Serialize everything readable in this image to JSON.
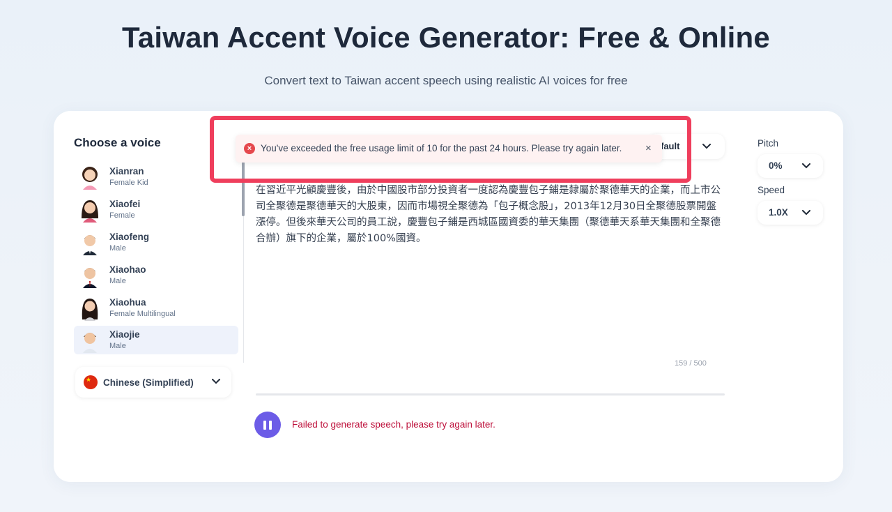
{
  "page": {
    "title": "Taiwan Accent Voice Generator: Free & Online",
    "subtitle": "Convert text to Taiwan accent speech using realistic AI voices for free"
  },
  "voices": {
    "heading": "Choose a voice",
    "items": [
      {
        "name": "Xianran",
        "desc": "Female Kid",
        "selected": false
      },
      {
        "name": "Xiaofei",
        "desc": "Female",
        "selected": false
      },
      {
        "name": "Xiaofeng",
        "desc": "Male",
        "selected": false
      },
      {
        "name": "Xiaohao",
        "desc": "Male",
        "selected": false
      },
      {
        "name": "Xiaohua",
        "desc": "Female Multilingual",
        "selected": false
      },
      {
        "name": "Xiaojie",
        "desc": "Male",
        "selected": true
      }
    ],
    "language": "Chinese (Simplified)"
  },
  "editor": {
    "style_label": "fault",
    "text": "在習近平光顧慶豐後，由於中國股市部分投資者一度認為慶豐包子鋪是隸屬於聚德華天的企業，而上市公司全聚德是聚德華天的大股東，因而市場視全聚德為「包子概念股」，2013年12月30日全聚德股票開盤漲停。但後來華天公司的員工說，慶豐包子鋪是西城區國資委的華天集團（聚德華天系華天集團和全聚德合辦）旗下的企業，屬於100%國資。",
    "char_count": "159 / 500"
  },
  "player": {
    "error": "Failed to generate speech, please try again later."
  },
  "controls": {
    "pitch_label": "Pitch",
    "pitch_value": "0%",
    "speed_label": "Speed",
    "speed_value": "1.0X"
  },
  "toast": {
    "message": "You've exceeded the free usage limit of 10 for the past 24 hours. Please try again later.",
    "icon": "error-circle-icon",
    "close": "×"
  },
  "colors": {
    "accent": "#6c5ce7",
    "error_text": "#be123c",
    "highlight": "#ef3e5c",
    "toast_bg": "#fef2f2"
  }
}
